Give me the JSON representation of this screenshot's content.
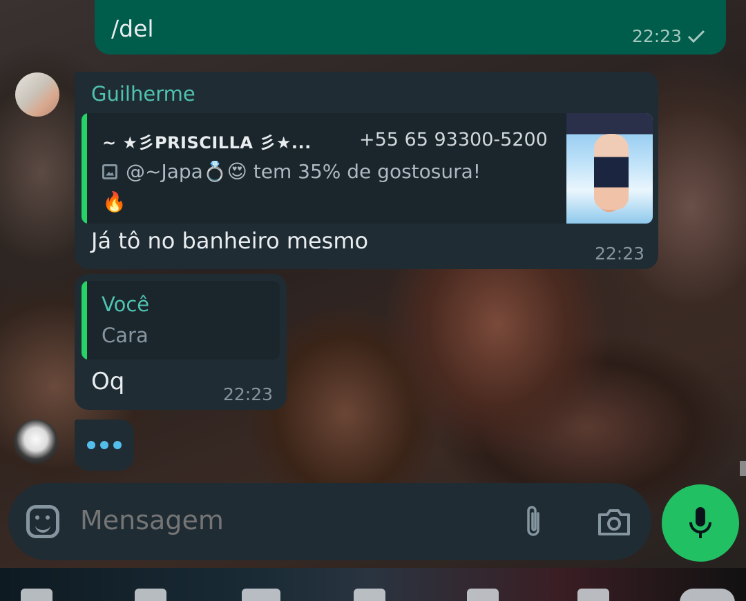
{
  "outgoing": {
    "text": "/del",
    "time": "22:23",
    "status_icon": "check-icon"
  },
  "messages": [
    {
      "sender": "Guilherme",
      "quote": {
        "author": "~ ★彡PRISCILLA 彡★...",
        "phone": "+55 65 93300-5200",
        "line2": "@~Japa💍😍 tem 35% de gostosura!",
        "line3": "🔥",
        "icon": "image-icon"
      },
      "text": "Já tô no banheiro mesmo",
      "time": "22:23"
    },
    {
      "quote": {
        "author": "Você",
        "text": "Cara"
      },
      "text": "Oq",
      "time": "22:23"
    }
  ],
  "composer": {
    "placeholder": "Mensagem"
  },
  "colors": {
    "accent": "#21c063",
    "bubble_out": "#005c4b",
    "bubble_in": "#1f2c34",
    "quote_bar": "#25d366",
    "typing_dots": "#53bdeb"
  }
}
